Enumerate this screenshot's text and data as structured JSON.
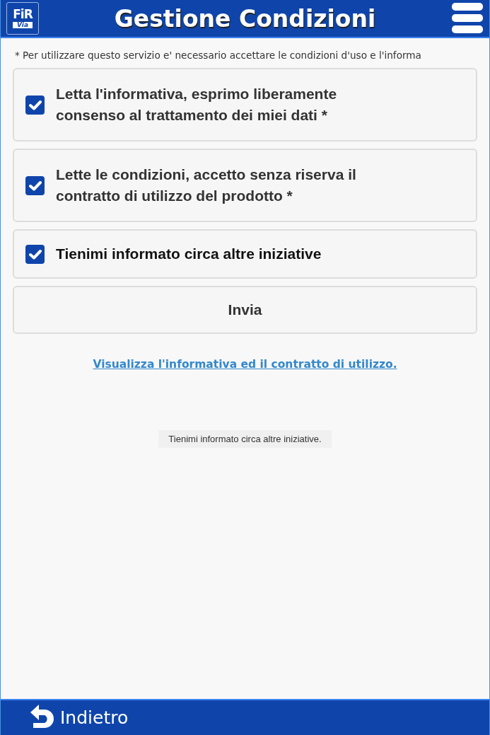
{
  "header": {
    "logo": {
      "top": "FiR",
      "bottom": "Via"
    },
    "title": "Gestione Condizioni"
  },
  "notice": "* Per utilizzare questo servizio e' necessario accettare le condizioni d'uso e l'informa",
  "options": [
    {
      "label": "Letta l'informativa, esprimo liberamente consenso al trattamento dei miei dati *",
      "checked": true
    },
    {
      "label": "Lette le condizioni, accetto senza riserva il contratto di utilizzo del prodotto *",
      "checked": true
    },
    {
      "label": "Tienimi informato circa altre iniziative",
      "checked": true
    }
  ],
  "submit": "Invia",
  "link": "Visualizza l'informativa ed il contratto di utilizzo.",
  "toast": "Tienimi informato circa altre iniziative.",
  "footer": {
    "back": "Indietro"
  }
}
